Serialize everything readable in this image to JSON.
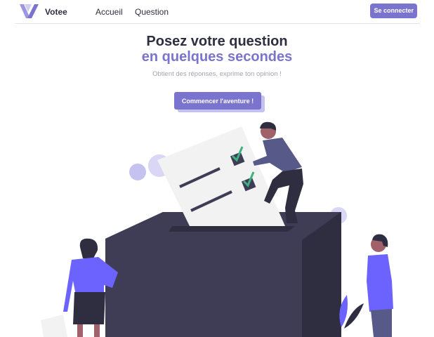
{
  "nav": {
    "brand": "Votee",
    "links": [
      "Accueil",
      "Question"
    ],
    "login_label": "Se connecter"
  },
  "hero": {
    "title_line1": "Posez votre question",
    "title_line2": "en quelques secondes",
    "subtitle": "Obtient des réponses, exprime ton opinion !",
    "cta_label": "Commencer l'aventure !"
  },
  "colors": {
    "accent": "#7a74cf",
    "accent_light": "#c6c2ef",
    "dark": "#2f2e41",
    "ballot_box": "#3f3d56",
    "check": "#3fb07f"
  },
  "icons": {
    "logo": "votee-logo-icon"
  }
}
